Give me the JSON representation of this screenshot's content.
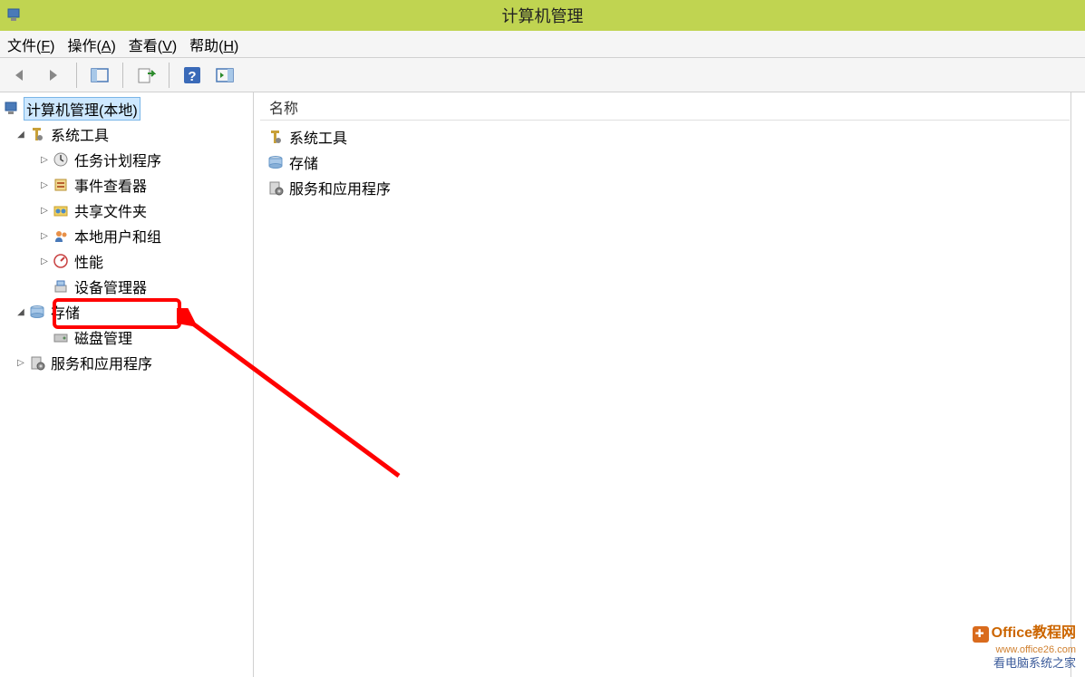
{
  "window": {
    "title": "计算机管理"
  },
  "menubar": {
    "file": "文件(",
    "file_u": "F",
    "file_end": ")",
    "action": "操作(",
    "action_u": "A",
    "action_end": ")",
    "view": "查看(",
    "view_u": "V",
    "view_end": ")",
    "help": "帮助(",
    "help_u": "H",
    "help_end": ")"
  },
  "toolbar": {
    "back": "back-icon",
    "forward": "forward-icon",
    "show_hide": "show-hide-icon",
    "export": "export-icon",
    "help": "help-icon",
    "snap": "snap-icon"
  },
  "tree": {
    "root": "计算机管理(本地)",
    "system_tools": "系统工具",
    "task_scheduler": "任务计划程序",
    "event_viewer": "事件查看器",
    "shared_folders": "共享文件夹",
    "local_users": "本地用户和组",
    "performance": "性能",
    "device_manager": "设备管理器",
    "storage": "存储",
    "disk_management": "磁盘管理",
    "services_apps": "服务和应用程序"
  },
  "list": {
    "header_name": "名称",
    "items": {
      "0": "系统工具",
      "1": "存储",
      "2": "服务和应用程序"
    }
  },
  "watermark": {
    "line1": "Office教程网",
    "line2": "www.office26.com",
    "line3": "看电脑系统之家"
  }
}
